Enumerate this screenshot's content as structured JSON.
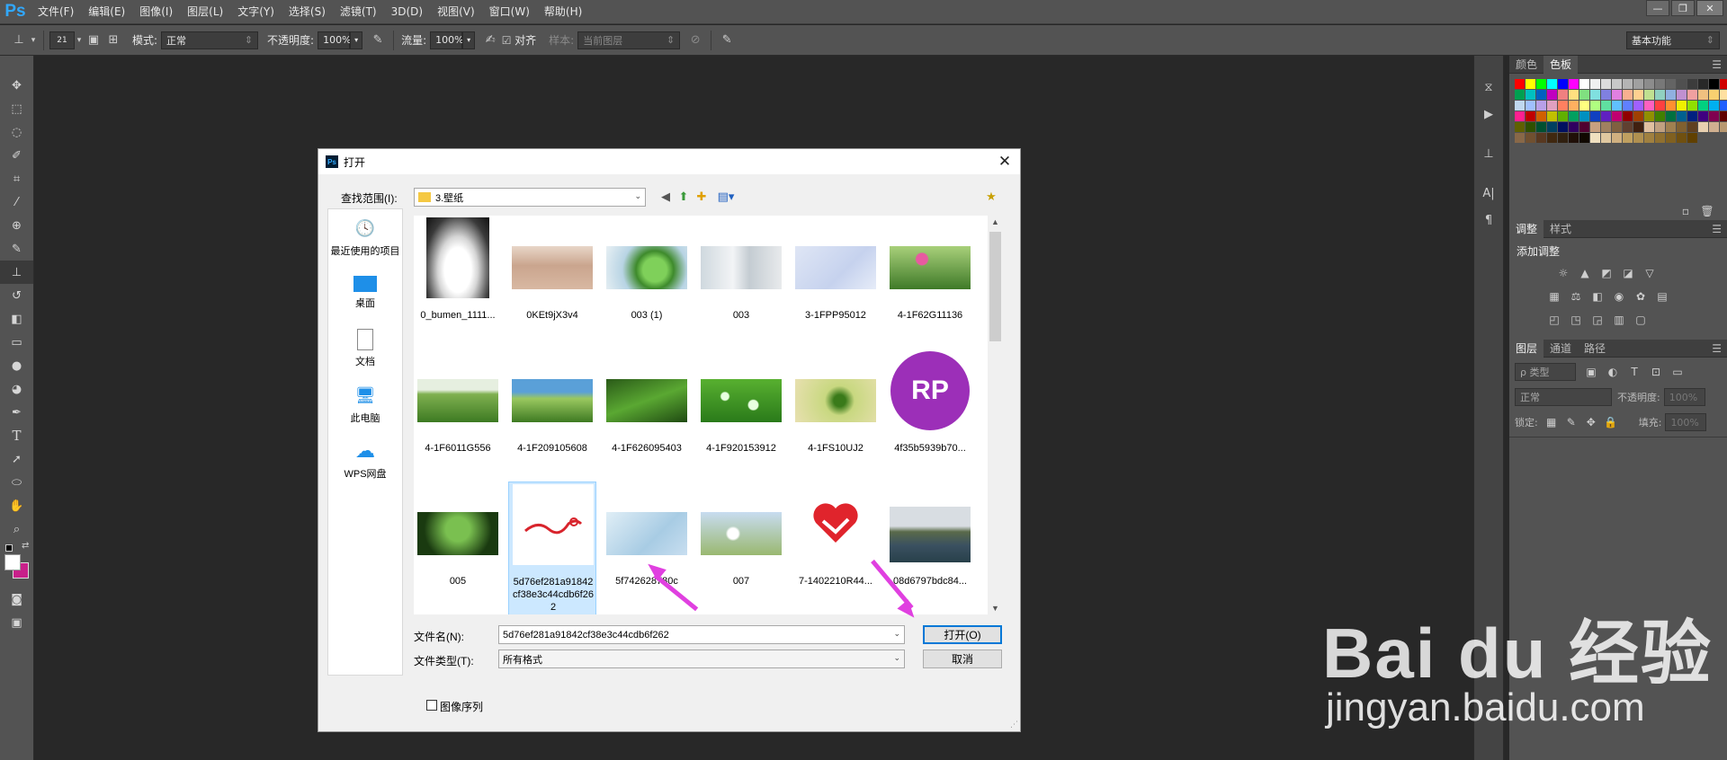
{
  "app": {
    "logo": "Ps",
    "menus": [
      "文件(F)",
      "编辑(E)",
      "图像(I)",
      "图层(L)",
      "文字(Y)",
      "选择(S)",
      "滤镜(T)",
      "3D(D)",
      "视图(V)",
      "窗口(W)",
      "帮助(H)"
    ],
    "workspace": "基本功能"
  },
  "options": {
    "brush_size": "21",
    "mode_label": "模式:",
    "mode_value": "正常",
    "opacity_label": "不透明度:",
    "opacity_value": "100%",
    "flow_label": "流量:",
    "flow_value": "100%",
    "align_label": "对齐",
    "sample_label": "样本:",
    "sample_value": "当前图层"
  },
  "panels": {
    "color_tabs": [
      "颜色",
      "色板"
    ],
    "adjust_tabs": [
      "调整",
      "样式"
    ],
    "adjust_title": "添加调整",
    "layer_tabs": [
      "图层",
      "通道",
      "路径"
    ],
    "layer_filter": "ρ 类型",
    "blend_mode": "正常",
    "opacity_label": "不透明度:",
    "lock_label": "锁定:",
    "fill_label": "填充:",
    "pct": "100%",
    "swatch_colors": [
      "#ff0000",
      "#ffff00",
      "#00ff00",
      "#00ffff",
      "#0000ff",
      "#ff00ff",
      "#ffffff",
      "#f0f0f0",
      "#dcdcdc",
      "#c8c8c8",
      "#b4b4b4",
      "#a0a0a0",
      "#8c8c8c",
      "#787878",
      "#646464",
      "#505050",
      "#3c3c3c",
      "#282828",
      "#000000",
      "#d00000",
      "#ffd000",
      "#00a050",
      "#00c0c0",
      "#0060c0",
      "#c000c0",
      "#f08080",
      "#ffe080",
      "#80e080",
      "#80e0e0",
      "#8080e0",
      "#e080e0",
      "#f8b090",
      "#ffd090",
      "#c0e090",
      "#90d0c0",
      "#90b0e0",
      "#c090d0",
      "#f0a0a0",
      "#f0c080",
      "#f8d070",
      "#ffe0a0",
      "#e8f0a0",
      "#c0d8f0",
      "#a0c0ff",
      "#b8a0e8",
      "#e0a0c0",
      "#ff8060",
      "#ffb060",
      "#ffff80",
      "#b0ff80",
      "#60e0a0",
      "#60c0ff",
      "#6080ff",
      "#a060ff",
      "#ff60c0",
      "#ff4040",
      "#ff9030",
      "#f0f000",
      "#90e000",
      "#00d080",
      "#00b0f0",
      "#2060ff",
      "#8030ff",
      "#ff2090",
      "#c00000",
      "#d06000",
      "#c0c000",
      "#60b000",
      "#00a060",
      "#0090c0",
      "#1040c0",
      "#6020c0",
      "#c00070",
      "#900000",
      "#a04000",
      "#909000",
      "#408000",
      "#007040",
      "#006090",
      "#002080",
      "#400080",
      "#800050",
      "#600000",
      "#703000",
      "#606000",
      "#305000",
      "#005030",
      "#004060",
      "#001060",
      "#300060",
      "#500030",
      "#c8a080",
      "#a08060",
      "#806040",
      "#604030",
      "#402010",
      "#e0c0a0",
      "#c0a080",
      "#a08050",
      "#806030",
      "#604020",
      "#e8d0b0",
      "#d0b090",
      "#b89870",
      "#a08060",
      "#886848",
      "#705030",
      "#583820",
      "#402810",
      "#302010",
      "#201008",
      "#100800",
      "#f0e0c0",
      "#e0c8a0",
      "#d0b080",
      "#c0a060",
      "#b09050",
      "#a08040",
      "#907030",
      "#806020",
      "#705010",
      "#604000"
    ]
  },
  "dialog": {
    "title": "打开",
    "lookin_label": "查找范围(I):",
    "lookin_value": "3.壁纸",
    "places": [
      "最近使用的项目",
      "桌面",
      "文档",
      "此电脑",
      "WPS网盘"
    ],
    "files": [
      "0_bumen_1111...",
      "0KEt9jX3v4",
      "003 (1)",
      "003",
      "3-1FPP95012",
      "4-1F62G11136",
      "4-1F6011G556",
      "4-1F209105608",
      "4-1F626095403",
      "4-1F920153912",
      "4-1FS10UJ2",
      "4f35b5939b70...",
      "005",
      "5d76ef281a91842cf38e3c44cdb6f262",
      "5f742628780c",
      "007",
      "7-1402210R44...",
      "08d6797bdc84..."
    ],
    "filename_label": "文件名(N):",
    "filename_value": "5d76ef281a91842cf38e3c44cdb6f262",
    "filetype_label": "文件类型(T):",
    "filetype_value": "所有格式",
    "open_label": "打开(O)",
    "cancel_label": "取消",
    "image_sequence_label": "图像序列",
    "rp_text": "RP"
  },
  "watermark": {
    "brand": "Bai du 经验",
    "url": "jingyan.baidu.com"
  },
  "colors": {
    "ui_bg": "#535353",
    "canvas_bg": "#282828",
    "selection": "#cce8ff",
    "arrow": "#e040e0",
    "default_button_border": "#0078d7"
  }
}
